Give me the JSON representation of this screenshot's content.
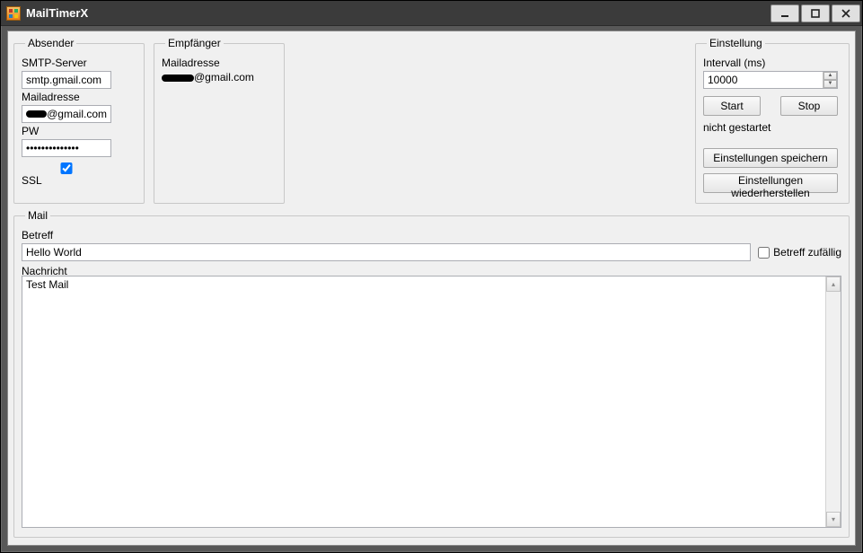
{
  "window": {
    "title": "MailTimerX"
  },
  "absender": {
    "legend": "Absender",
    "smtp_label": "SMTP-Server",
    "smtp_value": "smtp.gmail.com",
    "mail_label": "Mailadresse",
    "mail_suffix": "@gmail.com",
    "pw_label": "PW",
    "pw_value": "••••••••••••••",
    "ssl_label": "SSL",
    "ssl_checked": true
  },
  "empfaenger": {
    "legend": "Empfänger",
    "mail_label": "Mailadresse",
    "mail_suffix": "@gmail.com"
  },
  "einstellung": {
    "legend": "Einstellung",
    "interval_label": "Intervall (ms)",
    "interval_value": "10000",
    "start_label": "Start",
    "stop_label": "Stop",
    "status": "nicht gestartet",
    "save_label": "Einstellungen speichern",
    "restore_label": "Einstellungen wiederherstellen"
  },
  "mail": {
    "legend": "Mail",
    "betreff_label": "Betreff",
    "betreff_value": "Hello World",
    "betreff_random_label": "Betreff zufällig",
    "betreff_random_checked": false,
    "nachricht_label": "Nachricht",
    "nachricht_value": "Test Mail"
  }
}
